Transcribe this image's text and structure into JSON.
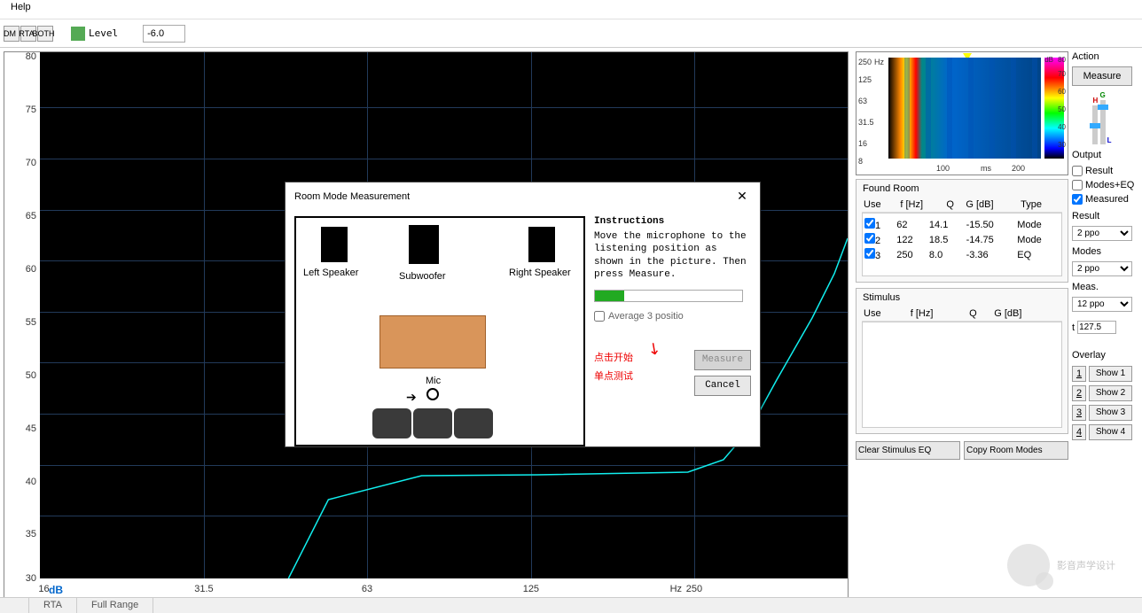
{
  "menu": {
    "help": "Help"
  },
  "toolbar": {
    "b1": "DM",
    "b2": "RTA",
    "b3": "BOTH",
    "level_label": "Level",
    "level_value": "-6.0"
  },
  "chart_data": {
    "type": "line",
    "title": "",
    "xlabel": "Hz",
    "ylabel": "dB",
    "xscale": "log",
    "xlim": [
      16,
      500
    ],
    "ylim": [
      30,
      80
    ],
    "yticks": [
      30,
      35,
      40,
      45,
      50,
      55,
      60,
      65,
      70,
      75,
      80
    ],
    "xticks": [
      16,
      31.5,
      63,
      125,
      250
    ],
    "series": [
      {
        "name": "measured",
        "color": "#2dd",
        "x": [
          250,
          300,
          350,
          400,
          500
        ],
        "y": [
          40,
          48,
          50,
          55,
          65
        ]
      }
    ]
  },
  "spectrogram": {
    "y_ticks": [
      "250",
      "125",
      "63",
      "31.5",
      "16",
      "8"
    ],
    "y_unit": "Hz",
    "x_ticks": [
      "100",
      "200"
    ],
    "x_unit": "ms",
    "cb_ticks": [
      "80",
      "70",
      "60",
      "50",
      "40",
      "30"
    ],
    "cb_unit": "dB"
  },
  "found_room": {
    "title": "Found Room",
    "cols": [
      "Use",
      "f [Hz]",
      "Q",
      "G [dB]",
      "Type"
    ],
    "rows": [
      {
        "use": true,
        "n": "1",
        "f": "62",
        "q": "14.1",
        "g": "-15.50",
        "t": "Mode"
      },
      {
        "use": true,
        "n": "2",
        "f": "122",
        "q": "18.5",
        "g": "-14.75",
        "t": "Mode"
      },
      {
        "use": true,
        "n": "3",
        "f": "250",
        "q": "8.0",
        "g": "-3.36",
        "t": "EQ"
      }
    ]
  },
  "stimulus": {
    "title": "Stimulus",
    "cols": [
      "Use",
      "f [Hz]",
      "Q",
      "G [dB]"
    ],
    "clear_btn": "Clear Stimulus EQ",
    "copy_btn": "Copy Room Modes"
  },
  "action": {
    "title": "Action",
    "measure_btn": "Measure",
    "output_title": "Output",
    "chk_result": "Result",
    "chk_modeseq": "Modes+EQ",
    "chk_measured": "Measured",
    "result_title": "Result",
    "result_val": "2 ppo",
    "modes_title": "Modes",
    "modes_val": "2 ppo",
    "meas_title": "Meas.",
    "meas_val": "12 ppo",
    "t_label": "t",
    "t_val": "127.5",
    "overlay_title": "Overlay",
    "overlay": [
      "Show 1",
      "Show 2",
      "Show 3",
      "Show 4"
    ],
    "slider_labels": {
      "h": "H",
      "g": "G",
      "l": "L"
    }
  },
  "dialog": {
    "title": "Room Mode Measurement",
    "left_speaker": "Left Speaker",
    "subwoofer": "Subwoofer",
    "right_speaker": "Right Speaker",
    "mic": "Mic",
    "instr_title": "Instructions",
    "instr_text": "Move the microphone to the listening position as shown in the picture. Then press Measure.",
    "avg_chk": "Average 3 positio",
    "red_text1": "点击开始",
    "red_text2": "单点测试",
    "measure_btn": "Measure",
    "cancel_btn": "Cancel"
  },
  "status": {
    "s1": "",
    "s2": "RTA",
    "s3": "Full Range"
  },
  "watermark": "影音声学设计"
}
